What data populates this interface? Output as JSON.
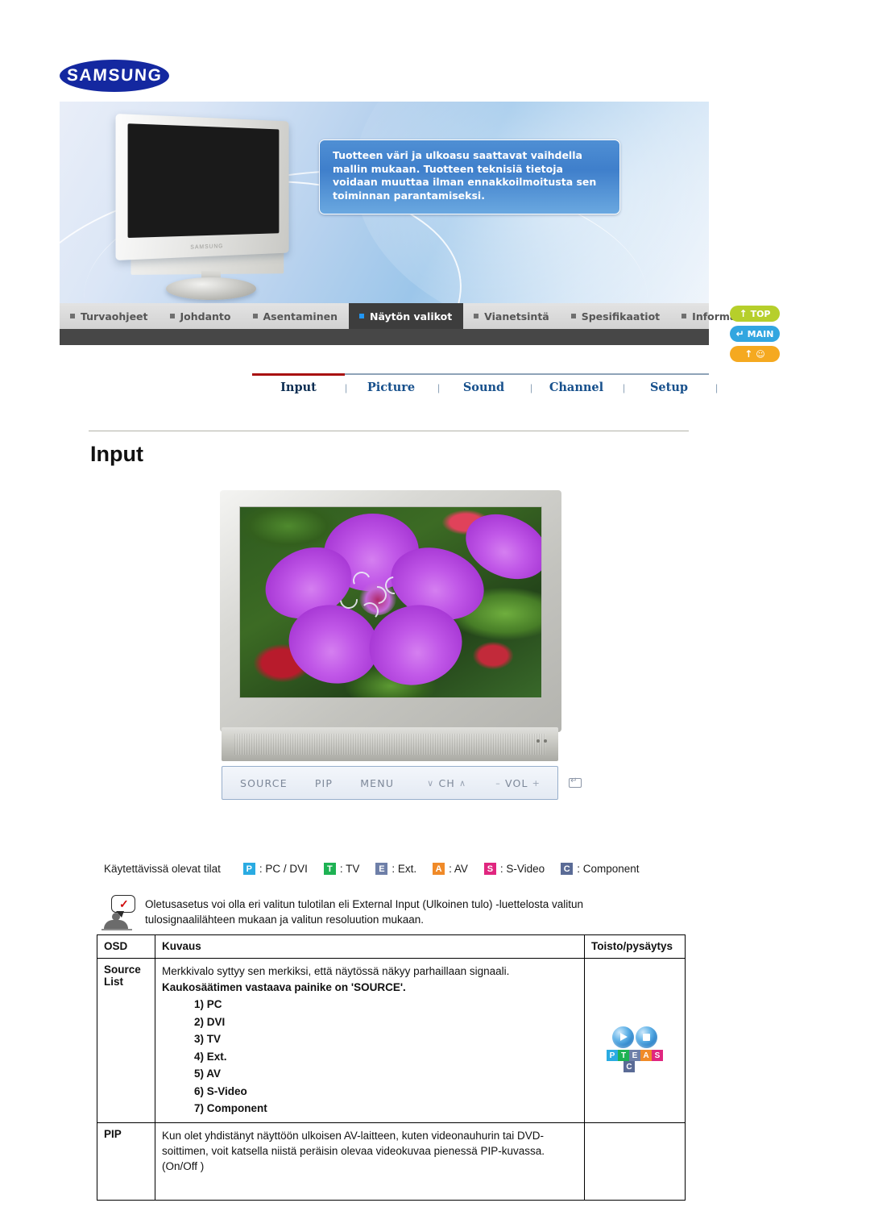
{
  "brand": {
    "logo_text": "SAMSUNG"
  },
  "hero": {
    "notice": "Tuotteen väri ja ulkoasu saattavat vaihdella mallin mukaan. Tuotteen teknisiä tietoja voidaan muuttaa ilman ennakkoilmoitusta sen toiminnan parantamiseksi.",
    "tv_brand_label": "SAMSUNG"
  },
  "nav": {
    "items": [
      {
        "label": "Turvaohjeet",
        "active": false
      },
      {
        "label": "Johdanto",
        "active": false
      },
      {
        "label": "Asentaminen",
        "active": false
      },
      {
        "label": "Näytön valikot",
        "active": true
      },
      {
        "label": "Vianetsintä",
        "active": false
      },
      {
        "label": "Spesifikaatiot",
        "active": false
      },
      {
        "label": "Informaatiota",
        "active": false
      }
    ]
  },
  "side_buttons": [
    {
      "label": "TOP",
      "icon": "arrow-up-icon",
      "color": "#b6cf2b"
    },
    {
      "label": "MAIN",
      "icon": "home-arrow-icon",
      "color": "#32a6e0"
    },
    {
      "label": "",
      "icon": "arrow-up-book-icon",
      "color": "#f5a920"
    }
  ],
  "subtabs": {
    "items": [
      {
        "label": "Input",
        "current": true
      },
      {
        "label": "Picture",
        "current": false
      },
      {
        "label": "Sound",
        "current": false
      },
      {
        "label": "Channel",
        "current": false
      },
      {
        "label": "Setup",
        "current": false
      }
    ],
    "separator": "|",
    "active_underline_color": "#a81010"
  },
  "page": {
    "title": "Input"
  },
  "figure": {
    "controls": [
      "SOURCE",
      "PIP",
      "MENU",
      "CH",
      "VOL",
      "enter-icon"
    ],
    "ch_down": "∨",
    "ch_up": "∧",
    "vol_minus": "–",
    "vol_plus": "+",
    "ch_label": "CH",
    "vol_label": "VOL"
  },
  "legend": {
    "label": "Käytettävissä olevat tilat",
    "entries": [
      {
        "badge": "P",
        "text": ": PC / DVI",
        "color": "#2aabe2"
      },
      {
        "badge": "T",
        "text": ": TV",
        "color": "#1eb253"
      },
      {
        "badge": "E",
        "text": ": Ext.",
        "color": "#6e7fa8"
      },
      {
        "badge": "A",
        "text": ": AV",
        "color": "#f08a28"
      },
      {
        "badge": "S",
        "text": ": S-Video",
        "color": "#e0267f"
      },
      {
        "badge": "C",
        "text": ": Component",
        "color": "#5a6b96"
      }
    ]
  },
  "note": {
    "line1": "Oletusasetus voi olla eri valitun tulotilan eli External Input (Ulkoinen tulo) -luettelosta valitun",
    "line2": "tulosignaalilähteen mukaan ja valitun resoluution mukaan."
  },
  "table": {
    "headers": [
      "OSD",
      "Kuvaus",
      "Toisto/pysäytys"
    ],
    "rows": [
      {
        "osd_line1": "Source",
        "osd_line2": "List",
        "desc_plain": "Merkkivalo syttyy sen merkiksi, että näytössä näkyy parhaillaan signaali.",
        "desc_bold": "Kaukosäätimen vastaava painike on 'SOURCE'.",
        "sources": [
          "1) PC",
          "2) DVI",
          "3) TV",
          "4) Ext.",
          "5) AV",
          "6) S-Video",
          "7) Component"
        ],
        "modes": [
          "P",
          "T",
          "E",
          "A",
          "S",
          "C"
        ]
      },
      {
        "osd_line1": "PIP",
        "osd_line2": "",
        "desc_plain": "Kun olet yhdistänyt näyttöön ulkoisen AV-laitteen, kuten videonauhurin tai DVD-soittimen, voit katsella niistä peräisin olevaa videokuvaa pienessä PIP-kuvassa. (On/Off )",
        "desc_bold": "",
        "sources": [],
        "modes": []
      }
    ]
  }
}
